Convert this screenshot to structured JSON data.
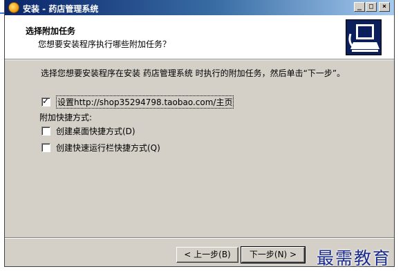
{
  "window": {
    "title": "安装 - 药店管理系统",
    "minimize_glyph": "_",
    "maximize_glyph": "□",
    "close_glyph": "×"
  },
  "header": {
    "title": "选择附加任务",
    "subtitle": "您想要安装程序执行哪些附加任务？",
    "logo_icon": "installer-computer-icon"
  },
  "body": {
    "description": "选择您想要安装程序在安装 药店管理系统 时执行的附加任务，然后单击“下一步”。",
    "tasks": [
      {
        "label": "设置http://shop35294798.taobao.com/主页",
        "checked": true
      },
      {
        "label": "创建桌面快捷方式(D)",
        "checked": false
      },
      {
        "label": "创建快速运行栏快捷方式(Q)",
        "checked": false
      }
    ],
    "shortcut_section_label": "附加快捷方式:"
  },
  "footer": {
    "back_label": "< 上一步(B)",
    "next_label": "下一步(N) >"
  },
  "watermark": "最需教育",
  "colors": {
    "titlebar_start": "#0a246a",
    "titlebar_end": "#a6caf0",
    "dialog_bg": "#d4d0c8",
    "watermark": "#1a2b8f"
  }
}
